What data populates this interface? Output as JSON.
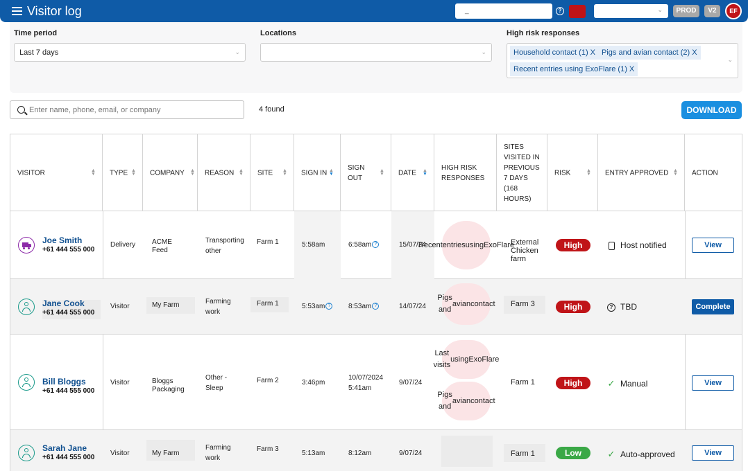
{
  "header": {
    "title": "Visitor log",
    "search_value": "_",
    "env_badge": "PROD",
    "version_badge": "V2",
    "user_initials": "EF",
    "colors": {
      "primary": "#0f5ba7",
      "danger": "#c01418",
      "accent": "#1a8fe0"
    }
  },
  "filters": {
    "time_period": {
      "label": "Time period",
      "value": "Last 7 days"
    },
    "locations": {
      "label": "Locations",
      "value": ""
    },
    "high_risk": {
      "label": "High risk responses",
      "chips": [
        "Household contact (1)",
        "Pigs and avian contact (2)",
        "Recent entries using ExoFlare (1)"
      ],
      "remove_glyph": "X"
    }
  },
  "search": {
    "placeholder": "Enter name, phone, email, or company",
    "found_text": "4 found"
  },
  "download_label": "DOWNLOAD",
  "table": {
    "columns": [
      "Visitor",
      "Type",
      "Company",
      "Reason",
      "Site",
      "Sign in",
      "Sign out",
      "Date",
      "High risk responses",
      "Sites visited in previous 7 days (168 hours)",
      "Risk",
      "Entry approved",
      "Action"
    ],
    "rows": [
      {
        "name": "Joe Smith",
        "phone": "+61 444 555 000",
        "icon": "truck-icon",
        "type": "Delivery",
        "company": [
          "ACME",
          "Feed"
        ],
        "reason": [
          "Transporting",
          "other"
        ],
        "site": "Farm 1",
        "sign_in": "5:58am",
        "sign_out": "6:58am",
        "date": "15/07/24",
        "high_risk": [
          [
            "Recent",
            "entries",
            "using",
            "ExoFlare"
          ]
        ],
        "sites_visited": [
          "External",
          "Chicken",
          "farm"
        ],
        "risk": "High",
        "approval": "Host notified",
        "approval_icon": "phone-icon",
        "action": "View"
      },
      {
        "name": "Jane Cook",
        "phone": "+61 444 555 000",
        "icon": "person-icon",
        "type": "Visitor",
        "company": [
          "My Farm"
        ],
        "reason": [
          "Farming",
          "work"
        ],
        "site": "Farm 1",
        "sign_in": "5:53am",
        "sign_out": "8:53am",
        "date": "14/07/24",
        "high_risk": [
          [
            "Pigs and",
            "avian",
            "contact"
          ]
        ],
        "sites_visited": [
          "Farm 3"
        ],
        "risk": "High",
        "approval": "TBD",
        "approval_icon": "help-icon",
        "action": "Complete"
      },
      {
        "name": "Bill Bloggs",
        "phone": "+61 444 555 000",
        "icon": "person-icon",
        "type": "Visitor",
        "company": [
          "Bloggs",
          "Packaging"
        ],
        "reason": [
          "Other -",
          "Sleep"
        ],
        "site": "Farm 2",
        "sign_in": "3:46pm",
        "sign_out": [
          "10/07/2024",
          "5:41am"
        ],
        "date": "9/07/24",
        "high_risk": [
          [
            "Last visits",
            "using",
            "ExoFlare"
          ],
          [
            "Pigs and",
            "avian",
            "contact"
          ]
        ],
        "sites_visited": [
          "Farm 1"
        ],
        "risk": "High",
        "approval": "Manual",
        "approval_icon": "check-icon",
        "action": "View"
      },
      {
        "name": "Sarah Jane",
        "phone": "+61 444 555 000",
        "icon": "person-icon",
        "type": "Visitor",
        "company": [
          "My Farm"
        ],
        "reason": [
          "Farming",
          "work"
        ],
        "site": "Farm 3",
        "sign_in": "5:13am",
        "sign_out": "8:12am",
        "date": "9/07/24",
        "high_risk": [],
        "sites_visited": [
          "Farm 1"
        ],
        "risk": "Low",
        "approval": "Auto-approved",
        "approval_icon": "check-icon",
        "action": "View"
      }
    ]
  }
}
